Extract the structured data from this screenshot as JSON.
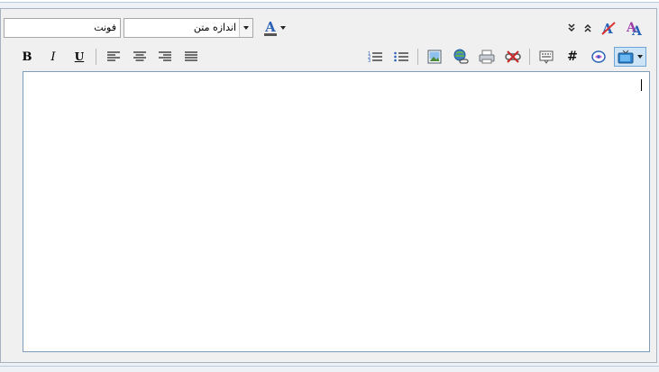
{
  "fonts": {
    "font_select_value": "فونت",
    "size_select_value": "اندازه متن"
  },
  "text_color_letter": "A",
  "icons": {
    "bold": "B",
    "italic": "I",
    "underline": "U",
    "hash": "#"
  },
  "colors": {
    "accent": "#2a62b8",
    "frame": "#a6b2c2",
    "editor_border": "#7f9db9"
  }
}
